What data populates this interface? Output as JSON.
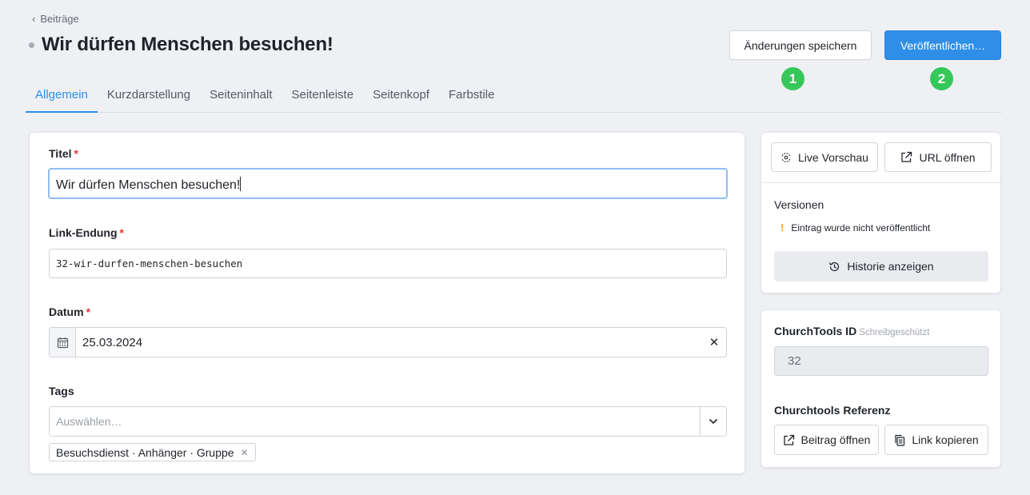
{
  "breadcrumb": {
    "back_label": "Beiträge"
  },
  "header": {
    "title": "Wir dürfen Menschen besuchen!",
    "save_label": "Änderungen speichern",
    "publish_label": "Veröffentlichen…",
    "badge1": "1",
    "badge2": "2"
  },
  "tabs": [
    {
      "label": "Allgemein",
      "active": true
    },
    {
      "label": "Kurzdarstellung"
    },
    {
      "label": "Seiteninhalt"
    },
    {
      "label": "Seitenleiste"
    },
    {
      "label": "Seitenkopf"
    },
    {
      "label": "Farbstile"
    }
  ],
  "form": {
    "title_label": "Titel",
    "title_value": "Wir dürfen Menschen besuchen!",
    "link_label": "Link-Endung",
    "link_value": "32-wir-durfen-menschen-besuchen",
    "date_label": "Datum",
    "date_value": "25.03.2024",
    "tags_label": "Tags",
    "tags_placeholder": "Auswählen…",
    "tag_chip": "Besuchsdienst · Anhänger · Gruppe",
    "required_mark": "*"
  },
  "sidebar": {
    "live_preview_label": "Live Vorschau",
    "open_url_label": "URL öffnen",
    "versions_label": "Versionen",
    "version_warning_mark": "!",
    "version_warning": "Eintrag wurde nicht veröffentlicht",
    "history_label": "Historie anzeigen",
    "ct_id_label": "ChurchTools ID",
    "ct_id_note": "Schreibgeschützt",
    "ct_id_value": "32",
    "ct_ref_label": "Churchtools Referenz",
    "open_post_label": "Beitrag öffnen",
    "copy_link_label": "Link kopieren"
  },
  "colors": {
    "accent": "#2f8fe8",
    "badge": "#35c75a",
    "required": "#e03a3a",
    "warning": "#f0a020"
  }
}
